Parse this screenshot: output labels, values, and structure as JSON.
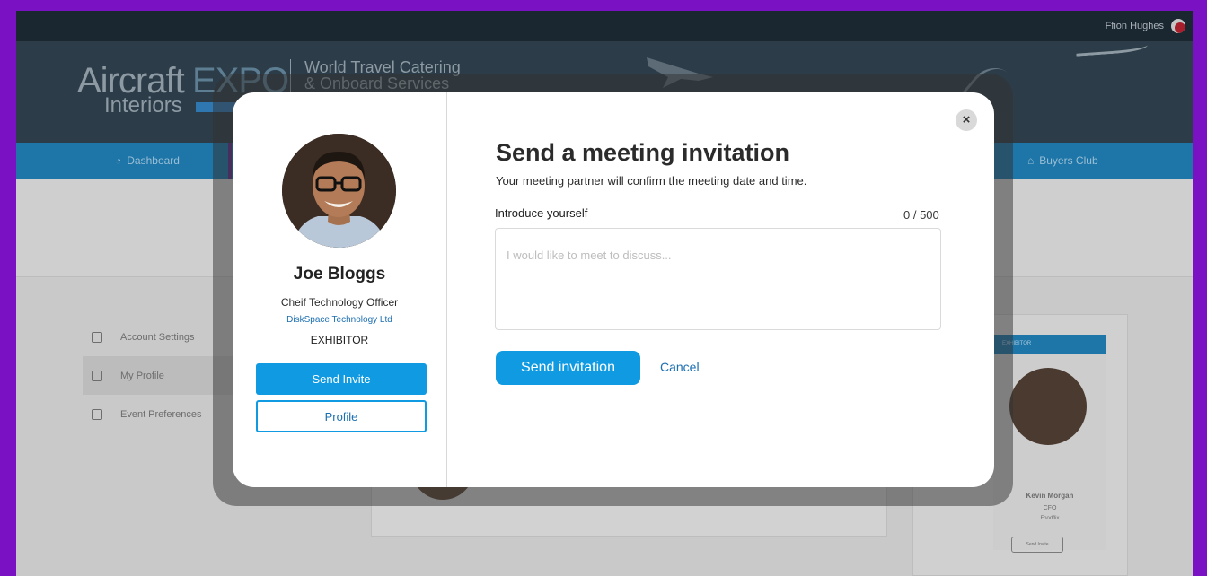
{
  "topbar": {
    "user_name": "Ffion Hughes"
  },
  "banner": {
    "logo_aircraft": "Aircraft",
    "logo_expo": "EXPO",
    "logo_interiors": "Interiors",
    "logo_wtc_line1": "World Travel Catering",
    "logo_wtc_line2": "& Onboard Services"
  },
  "navbar": {
    "dashboard_label": "Dashboard",
    "buyers_club_label": "Buyers Club"
  },
  "sidebar": {
    "items": [
      {
        "label": "Account Settings",
        "icon": "user-settings-icon"
      },
      {
        "label": "My Profile",
        "icon": "id-card-icon"
      },
      {
        "label": "Event Preferences",
        "icon": "preferences-icon"
      }
    ]
  },
  "background_card": {
    "tag": "EXHIBITOR",
    "name": "Kevin Morgan",
    "role": "CFO",
    "company": "Foodflix",
    "button": "Send Invite"
  },
  "modal": {
    "person": {
      "name": "Joe Bloggs",
      "title": "Cheif Technology Officer",
      "company": "DiskSpace Technology Ltd",
      "type": "EXHIBITOR"
    },
    "send_invite_label": "Send Invite",
    "profile_label": "Profile",
    "close_icon": "×",
    "title": "Send a meeting invitation",
    "subtitle": "Your meeting partner will confirm the meeting date and time.",
    "intro_label": "Introduce yourself",
    "counter": "0 / 500",
    "intro_placeholder": "I would like to meet to discuss...",
    "intro_value": "",
    "send_invitation_label": "Send invitation",
    "cancel_label": "Cancel"
  },
  "colors": {
    "frame": "#7a12c4",
    "primary_button": "#0f9ae1",
    "link": "#1c6fb0",
    "navbar": "#1d75a8",
    "topbar": "#1a2731"
  }
}
